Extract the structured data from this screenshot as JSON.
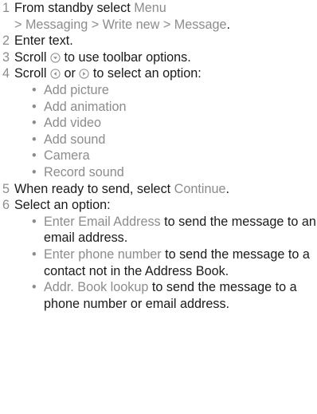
{
  "steps": [
    {
      "num": "1",
      "line1": "From standby select ",
      "menu": "Menu",
      "sep": "> ",
      "path": "Messaging > Write new > Message",
      "end": "."
    },
    {
      "num": "2",
      "text": "Enter text."
    },
    {
      "num": "3",
      "before": "Scroll ",
      "after": " to use toolbar options."
    },
    {
      "num": "4",
      "before": "Scroll ",
      "mid": " or ",
      "after": " to select an option:",
      "options": [
        "Add picture",
        "Add animation",
        "Add video",
        "Add sound",
        "Camera",
        "Record sound"
      ]
    },
    {
      "num": "5",
      "before": "When ready to send, select ",
      "highlight": "Continue",
      "after": "."
    },
    {
      "num": "6",
      "text": "Select an option:",
      "options": [
        {
          "label": "Enter Email Address",
          "desc": " to send the message to an email address."
        },
        {
          "label": "Enter phone number",
          "desc": " to send the message to a contact not in the Address Book."
        },
        {
          "label": "Addr. Book lookup",
          "desc": " to send the message to a phone number or email address."
        }
      ]
    }
  ],
  "bullet": "•",
  "icons": [
    "navigation-key-down-icon",
    "navigation-key-left-icon",
    "navigation-key-right-icon"
  ]
}
